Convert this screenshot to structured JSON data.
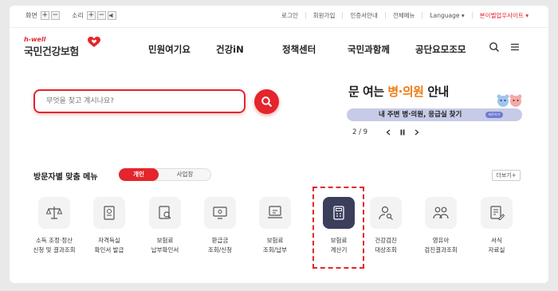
{
  "util": {
    "screen_label": "화면",
    "sound_label": "소리",
    "plus": "+",
    "minus": "−",
    "links": [
      "로그인",
      "회원가입",
      "인증서안내",
      "전체메뉴",
      "Language ▾"
    ],
    "sites": "본이벨업우사이트 ▾"
  },
  "logo": {
    "sub": "h-well",
    "main": "국민건강보험"
  },
  "gnb": [
    "민원여기요",
    "건강iN",
    "정책센터",
    "국민과함께",
    "공단요모조모"
  ],
  "search": {
    "placeholder": "무엇을 찾고 계시나요?"
  },
  "banner": {
    "title_a": "문 여는 ",
    "title_hl": "병·의원",
    "title_b": " 안내",
    "bar_text": "내 주변 병·의원, 응급실 찾기",
    "more": "바로가기",
    "counter": "2 / 9"
  },
  "menu": {
    "title": "방문자별 맞춤 메뉴",
    "tab_active": "개인",
    "tab_inactive": "사업장",
    "more": "더보기+",
    "tiles": [
      "소득 조정·정산\n신청 및 결과조회",
      "자격득실\n확인서 발급",
      "보험료\n납부확인서",
      "환급금\n조회/신청",
      "보험료\n조회/납부",
      "보험료\n계산기",
      "건강검진\n대상조회",
      "영유아\n검진결과조회",
      "서식\n자료실"
    ]
  },
  "colors": {
    "brand": "#e4252b",
    "active_tile": "#3b3f5c",
    "banner_bar": "#c7cbe8",
    "highlight": "#f07b10"
  }
}
